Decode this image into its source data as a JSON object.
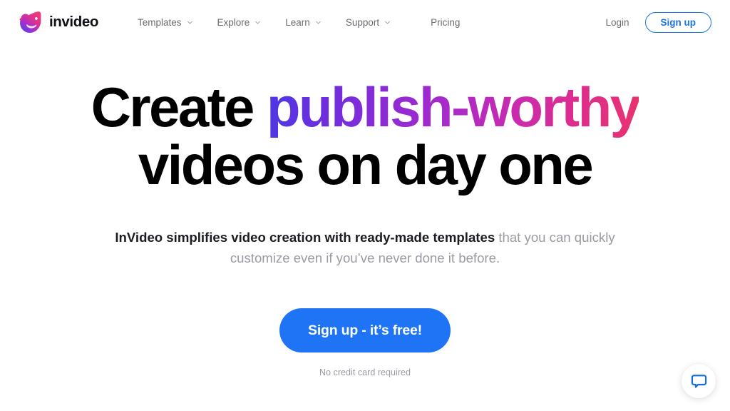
{
  "brand": {
    "wordmark": "invideo",
    "logo_icon": "invideo-bird-logo",
    "logo_colors": {
      "start": "#e8336e",
      "mid": "#c62bae",
      "end": "#5b3fe8"
    }
  },
  "header": {
    "nav": [
      {
        "label": "Templates",
        "has_chevron": true
      },
      {
        "label": "Explore",
        "has_chevron": true
      },
      {
        "label": "Learn",
        "has_chevron": true
      },
      {
        "label": "Support",
        "has_chevron": true
      },
      {
        "label": "Pricing",
        "has_chevron": false
      }
    ],
    "login_label": "Login",
    "signup_label": "Sign up",
    "accent_blue": "#1a73e8"
  },
  "hero": {
    "headline_line1_black": "Create ",
    "headline_line1_gradient": "publish-worthy",
    "headline_line2": "videos on day one",
    "gradient_colors": {
      "start": "#4b39e4",
      "mid": "#aa2ac8",
      "end": "#e8336e"
    },
    "subcopy_strong": "InVideo simplifies video creation with ready-made templates",
    "subcopy_muted": " that you can quickly customize even if you’ve never done it before.",
    "cta_label": "Sign up - it’s free!",
    "cta_color": "#1f74f5",
    "cta_note": "No credit card required"
  },
  "chat": {
    "icon": "chat-bubble-icon",
    "icon_color": "#1a6fe0"
  }
}
